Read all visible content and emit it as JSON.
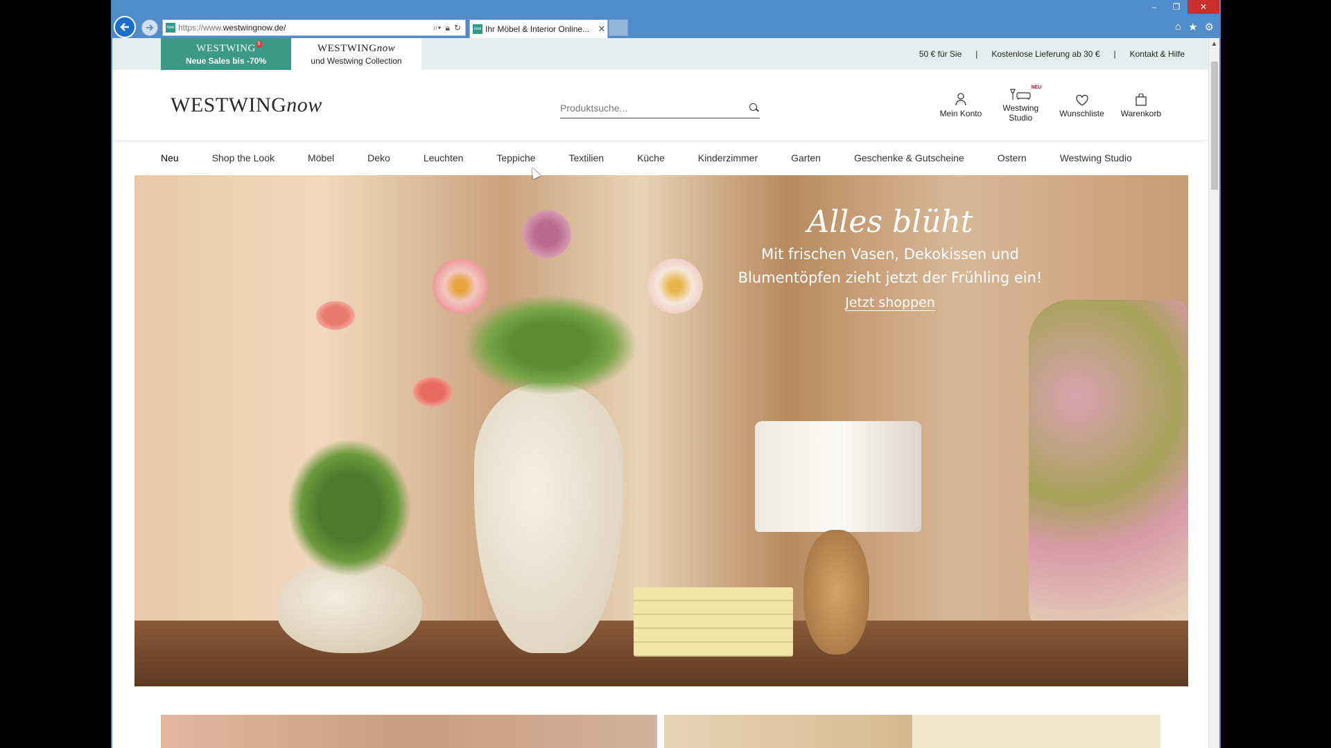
{
  "browser": {
    "url_prefix": "https://www.",
    "url_domain": "westwingnow.de/",
    "tab_title": "Ihr Möbel & Interior Online...",
    "favicon_text": "now"
  },
  "topbar": {
    "sales_brand": "WESTWING",
    "sales_badge": "5",
    "sales_label": "Neue Sales bis -70%",
    "now_brand_main": "WESTWING",
    "now_brand_italic": "now",
    "now_label": "und Westwing Collection",
    "links": [
      "50 € für Sie",
      "Kostenlose Lieferung ab 30 €",
      "Kontakt & Hilfe"
    ],
    "separator": "|"
  },
  "header": {
    "logo_main": "WESTWING",
    "logo_italic": "now",
    "search_placeholder": "Produktsuche...",
    "actions": {
      "account": "Mein Konto",
      "studio": "Westwing Studio",
      "studio_badge": "NEU",
      "wishlist": "Wunschliste",
      "cart": "Warenkorb"
    }
  },
  "nav": [
    "Neu",
    "Shop the Look",
    "Möbel",
    "Deko",
    "Leuchten",
    "Teppiche",
    "Textilien",
    "Küche",
    "Kinderzimmer",
    "Garten",
    "Geschenke & Gutscheine",
    "Ostern",
    "Westwing Studio"
  ],
  "hero": {
    "title": "Alles blüht",
    "line1": "Mit frischen Vasen, Dekokissen und",
    "line2": "Blumentöpfen zieht jetzt der Frühling ein!",
    "cta": "Jetzt shoppen"
  },
  "colors": {
    "titlebar": "#4f8cc9",
    "topbar_bg": "#e3efed",
    "sales_green": "#3c9986",
    "badge_red": "#c8102e"
  }
}
